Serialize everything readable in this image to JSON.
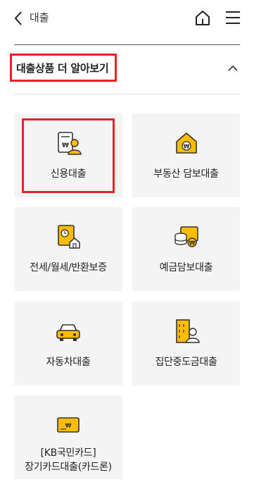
{
  "header": {
    "title": "대출",
    "back_icon": "chevron-left-icon",
    "home_icon": "home-icon",
    "menu_icon": "hamburger-menu-icon"
  },
  "section": {
    "title": "대출상품 더 알아보기",
    "toggle_icon": "chevron-up-icon"
  },
  "colors": {
    "accent": "#ffbc00",
    "highlight": "#e8222b",
    "card_bg": "#f4f4f4"
  },
  "products": [
    {
      "label": "신용대출",
      "icon": "credit-loan-icon"
    },
    {
      "label": "부동산 담보대출",
      "icon": "house-won-icon"
    },
    {
      "label": "전세/월세/반환보증",
      "icon": "lease-deposit-icon"
    },
    {
      "label": "예금담보대출",
      "icon": "deposit-coin-icon"
    },
    {
      "label": "자동차대출",
      "icon": "car-icon"
    },
    {
      "label": "집단중도금대출",
      "icon": "apartment-person-icon"
    },
    {
      "label_line1": "[KB국민카드]",
      "label_line2": "장기카드대출(카드론)",
      "icon": "card-icon"
    }
  ]
}
